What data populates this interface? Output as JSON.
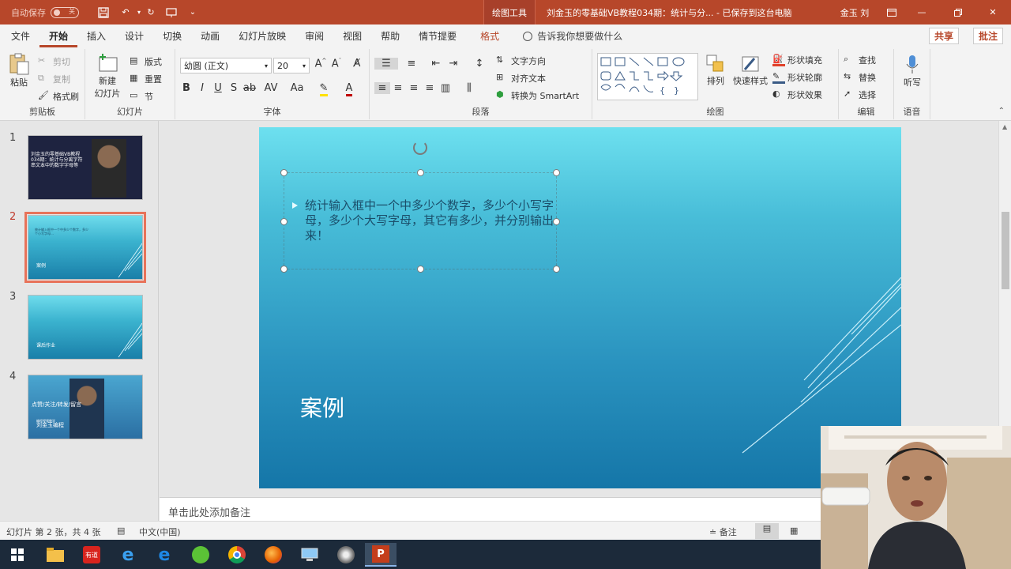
{
  "titlebar": {
    "autosave_label": "自动保存",
    "autosave_state": "关",
    "context_tab": "绘图工具",
    "document_title": "刘金玉的零基础VB教程034期：统计与分... - 已保存到这台电脑",
    "user_name": "金玉 刘"
  },
  "tabs": [
    "文件",
    "开始",
    "插入",
    "设计",
    "切换",
    "动画",
    "幻灯片放映",
    "审阅",
    "视图",
    "帮助",
    "情节提要",
    "格式"
  ],
  "tell_me": "告诉我你想要做什么",
  "share_label": "共享",
  "comment_label": "批注",
  "ribbon": {
    "clipboard": {
      "paste": "粘贴",
      "cut": "剪切",
      "copy": "复制",
      "format_painter": "格式刷",
      "group": "剪贴板"
    },
    "slides": {
      "new_slide": "新建",
      "new_slide2": "幻灯片",
      "layout": "版式",
      "reset": "重置",
      "section": "节",
      "group": "幻灯片"
    },
    "font": {
      "font_name": "幼圆 (正文)",
      "font_size": "20",
      "group": "字体"
    },
    "paragraph": {
      "text_direction": "文字方向",
      "align_text": "对齐文本",
      "smartart": "转换为 SmartArt",
      "group": "段落"
    },
    "drawing": {
      "arrange": "排列",
      "quick_styles": "快速样式",
      "shape_fill": "形状填充",
      "shape_outline": "形状轮廓",
      "shape_effects": "形状效果",
      "group": "绘图"
    },
    "editing": {
      "find": "查找",
      "replace": "替换",
      "select": "选择",
      "group": "编辑"
    },
    "voice": {
      "dictate": "听写",
      "group": "语音"
    }
  },
  "thumbnails": [
    {
      "num": "1",
      "text": "刘金玉的零基础VB教程034期：统计与分离字符串文本中的数字字母等"
    },
    {
      "num": "2",
      "text": "统计输入框中一个中多少个数字，多少个小写字母…",
      "footer": "案例"
    },
    {
      "num": "3",
      "text": "课后作业"
    },
    {
      "num": "4",
      "text": "点赞/关注/转发/留言",
      "sub": "编程视频教学",
      "author": "刘金玉编程"
    }
  ],
  "slide": {
    "body_text": "统计输入框中一个中多少个数字，多少个小写字母，多少个大写字母，其它有多少，并分别输出来！",
    "title": "案例"
  },
  "notes_placeholder": "单击此处添加备注",
  "status": {
    "slide_info": "幻灯片 第 2 张，共 4 张",
    "language": "中文(中国)",
    "notes_btn": "备注"
  },
  "taskbar_icons": [
    "windows-start",
    "file-explorer",
    "youdao",
    "ie",
    "edge",
    "wechat-green",
    "chrome",
    "firefox",
    "remote-desktop",
    "media",
    "powerpoint"
  ],
  "colors": {
    "accent": "#b7472a",
    "slide_top": "#6de0ef",
    "slide_bottom": "#1576a8"
  }
}
